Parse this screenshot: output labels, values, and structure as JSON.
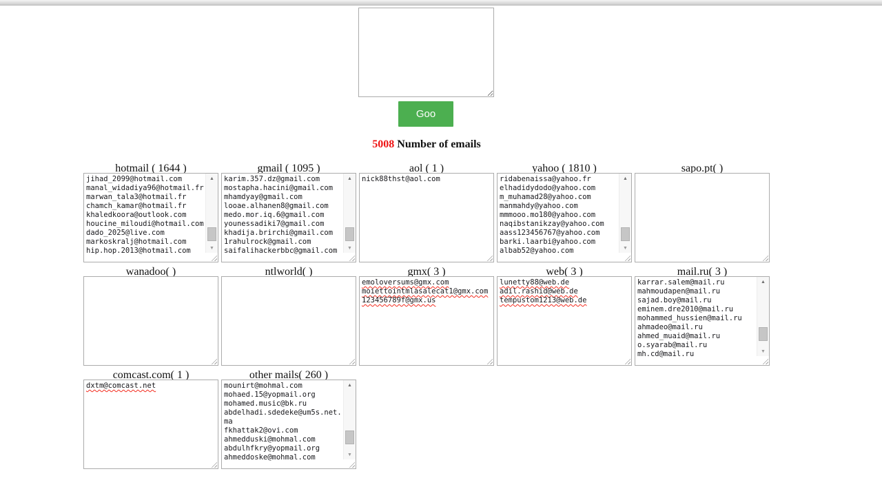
{
  "page": {
    "background": "#ffffff",
    "accent_green": "#4caf50",
    "count_red": "#ee1111",
    "border_grey": "#ababab"
  },
  "composer": {
    "input_value": "",
    "input_placeholder": "",
    "button_label": "Goo"
  },
  "summary": {
    "count": "5008",
    "label": "Number of emails"
  },
  "icons": {
    "scroll_up": "▲",
    "scroll_down": "▼"
  },
  "groups": [
    {
      "id": "hotmail",
      "header": "hotmail ( 1644 )",
      "count": "1644",
      "scrollbar": true,
      "thumb_pct": 95,
      "squiggle": false,
      "emails": [
        "jihad_2099@hotmail.com",
        "manal_widadiya96@hotmail.fr",
        "marwan_tala3@hotmail.fr",
        "chamch_kamar@hotmail.fr",
        "khaledkoora@outlook.com",
        "houcine_miloudi@hotmail.com",
        "dado_2025@live.com",
        "markoskralj@hotmail.com",
        "hip.hop.2013@hotmail.com"
      ]
    },
    {
      "id": "gmail",
      "header": "gmail ( 1095 )",
      "count": "1095",
      "scrollbar": true,
      "thumb_pct": 95,
      "squiggle": false,
      "emails": [
        "karim.357.dz@gmail.com",
        "mostapha.hacini@gmail.com",
        "mhamdyay@gmail.com",
        "looae.alhanen8@gmail.com",
        "medo.mor.iq.6@gmail.com",
        "younessadiki7@gmail.com",
        "khadija.brirchi@gmail.com",
        "1rahulrock@gmail.com",
        "saifalihackerbbc@gmail.com"
      ]
    },
    {
      "id": "aol",
      "header": "aol ( 1 )",
      "count": "1",
      "scrollbar": false,
      "squiggle": false,
      "emails": [
        "nick88thst@aol.com"
      ]
    },
    {
      "id": "yahoo",
      "header": "yahoo ( 1810 )",
      "count": "1810",
      "scrollbar": true,
      "thumb_pct": 95,
      "squiggle": false,
      "emails": [
        "ridabenaissa@yahoo.fr",
        "elhadidydodo@yahoo.com",
        "m_muhamad28@yahoo.com",
        "manmahdy@yahoo.com",
        "mmmooo.mo180@yahoo.com",
        "naqibstanikzay@yahoo.com",
        "aass123456767@yahoo.com",
        "barki.laarbi@yahoo.com",
        "albab52@yahoo.com"
      ]
    },
    {
      "id": "sapo-pt",
      "header": "sapo.pt( )",
      "count": "",
      "scrollbar": false,
      "squiggle": false,
      "emails": []
    },
    {
      "id": "wanadoo",
      "header": "wanadoo( )",
      "count": "",
      "scrollbar": false,
      "squiggle": false,
      "emails": []
    },
    {
      "id": "ntlworld",
      "header": "ntlworld( )",
      "count": "",
      "scrollbar": false,
      "squiggle": false,
      "emails": []
    },
    {
      "id": "gmx",
      "header": "gmx( 3 )",
      "count": "3",
      "scrollbar": false,
      "squiggle": true,
      "emails": [
        "emoloversums@gmx.com",
        "moiettointmlasalecat1@gmx.com",
        "123456789f@gmx.us"
      ]
    },
    {
      "id": "web",
      "header": "web( 3 )",
      "count": "3",
      "scrollbar": false,
      "squiggle": true,
      "emails": [
        "lunetty88@web.de",
        "adil.rashid@web.de",
        "tempustom1213@web.de"
      ]
    },
    {
      "id": "mail-ru",
      "header": "mail.ru( 3 )",
      "count": "3",
      "scrollbar": true,
      "thumb_pct": 88,
      "squiggle": false,
      "emails": [
        "karrar.salem@mail.ru",
        "mahmoudapen@mail.ru",
        "sajad.boy@mail.ru",
        "eminem.dre2010@mail.ru",
        "mohammed_hussien@mail.ru",
        "ahmadeo@mail.ru",
        "ahmed_muaid@mail.ru",
        "o.syarab@mail.ru",
        "mh.cd@mail.ru"
      ]
    },
    {
      "id": "comcast",
      "header": "comcast.com( 1 )",
      "count": "1",
      "scrollbar": false,
      "squiggle": true,
      "emails": [
        "dxtm@comcast.net"
      ]
    },
    {
      "id": "other-mails",
      "header": "other mails( 260 )",
      "count": "260",
      "scrollbar": true,
      "thumb_pct": 88,
      "squiggle": false,
      "emails": [
        "mounirt@mohmal.com",
        "mohaed.15@yopmail.org",
        "mohamed.music@bk.ru",
        "abdelhadi.sdedeke@um5s.net.ma",
        "fkhattak2@ovi.com",
        "ahmedduski@mohmal.com",
        "abdulhfkry@yopmail.org",
        "ahmeddoske@mohmal.com"
      ]
    }
  ],
  "layout": {
    "columns_per_row": 5
  }
}
